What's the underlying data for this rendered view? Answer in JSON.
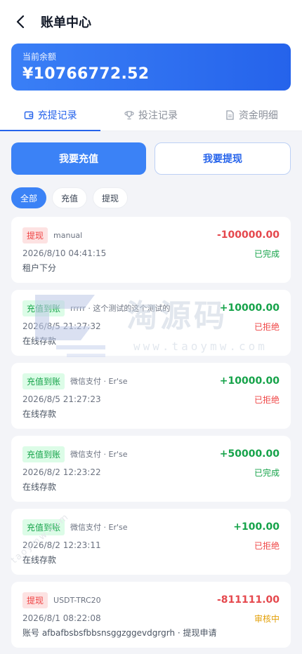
{
  "header": {
    "title": "账单中心"
  },
  "balance": {
    "label": "当前余额",
    "value": "¥10766772.52"
  },
  "tabs": [
    {
      "label": "充提记录",
      "icon": "wallet-icon"
    },
    {
      "label": "投注记录",
      "icon": "trophy-icon"
    },
    {
      "label": "资金明细",
      "icon": "document-icon"
    }
  ],
  "actions": {
    "recharge": "我要充值",
    "withdraw": "我要提现"
  },
  "filters": [
    "全部",
    "充值",
    "提现"
  ],
  "records": [
    {
      "badge": "提现",
      "badge_type": "withdraw",
      "desc": "manual",
      "amount": "-100000.00",
      "time": "2026/8/10 04:41:15",
      "status": "已完成",
      "note": "租户下分"
    },
    {
      "badge": "充值到账",
      "badge_type": "recharge",
      "desc": "rrrrr · 这个测试的这个测试的",
      "amount": "+10000.00",
      "time": "2026/8/5 21:27:32",
      "status": "已拒绝",
      "note": "在线存款"
    },
    {
      "badge": "充值到账",
      "badge_type": "recharge",
      "desc": "微信支付 · Er'se",
      "amount": "+10000.00",
      "time": "2026/8/5 21:27:23",
      "status": "已拒绝",
      "note": "在线存款"
    },
    {
      "badge": "充值到账",
      "badge_type": "recharge",
      "desc": "微信支付 · Er'se",
      "amount": "+50000.00",
      "time": "2026/8/2 12:23:22",
      "status": "已完成",
      "note": "在线存款"
    },
    {
      "badge": "充值到账",
      "badge_type": "recharge",
      "desc": "微信支付 · Er'se",
      "amount": "+100.00",
      "time": "2026/8/2 12:23:11",
      "status": "已拒绝",
      "note": "在线存款"
    },
    {
      "badge": "提现",
      "badge_type": "withdraw",
      "desc": "USDT-TRC20",
      "amount": "-811111.00",
      "time": "2026/8/1 08:22:08",
      "status": "审核中",
      "note": "账号 afbafbsbsfbbsnsggzggevdgrgrh · 提现申请"
    }
  ],
  "watermark": {
    "text": "淘源码",
    "url": "www.taoymw.com",
    "diag": "taoymw.com"
  },
  "colors": {
    "primary": "#3b82f6",
    "accent": "#2563eb",
    "success": "#16a34a",
    "danger": "#ef4444",
    "warning": "#e3a008"
  }
}
